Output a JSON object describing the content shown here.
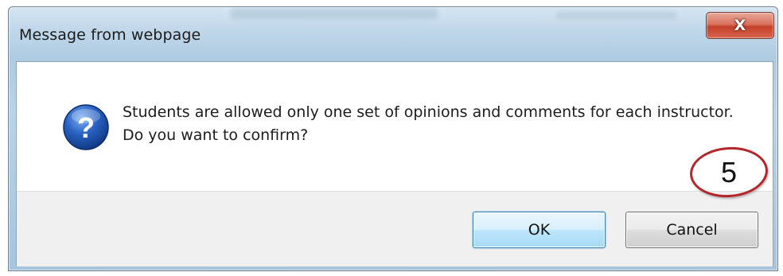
{
  "dialog": {
    "title": "Message from webpage",
    "close_label": "X",
    "message": "Students are allowed only one set of opinions and comments for each instructor. Do you want to confirm?",
    "icon": "question-icon",
    "ok_label": "OK",
    "cancel_label": "Cancel"
  },
  "annotation": {
    "number": "5",
    "color": "#b3262a"
  },
  "colors": {
    "ok_border": "#3c7fb1",
    "close_button": "#c4412b"
  }
}
